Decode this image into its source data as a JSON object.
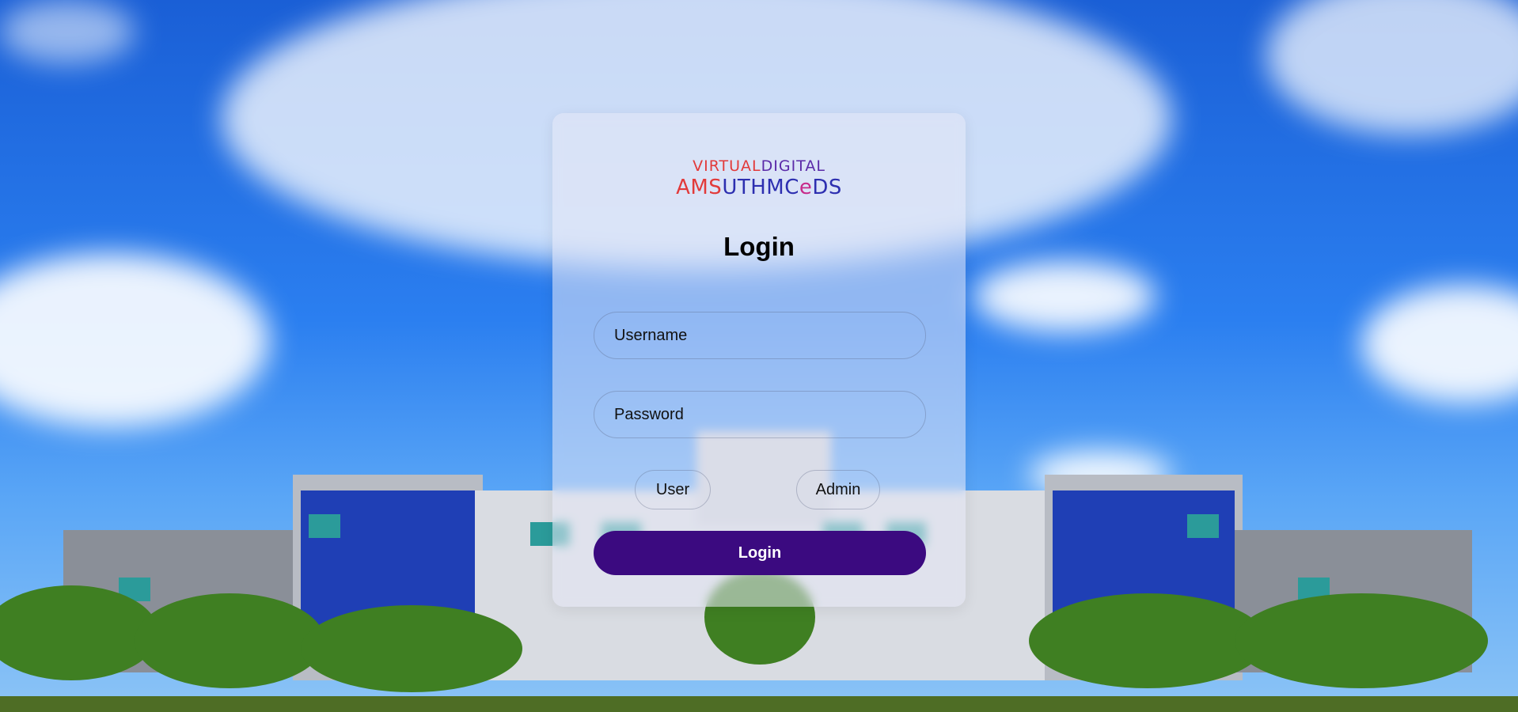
{
  "logo": {
    "line1_part1": "VIRTUAL",
    "line1_part2": "DIGITAL",
    "line2_part1": "AMS",
    "line2_part2": "UTHMC",
    "line2_part3": "e",
    "line2_part4": "DS"
  },
  "login": {
    "title": "Login",
    "username_placeholder": "Username",
    "password_placeholder": "Password",
    "role_user": "User",
    "role_admin": "Admin",
    "submit_label": "Login"
  },
  "colors": {
    "button_bg": "#3b0a80",
    "logo_red": "#e23a3a",
    "logo_purple": "#5a2aa8"
  }
}
